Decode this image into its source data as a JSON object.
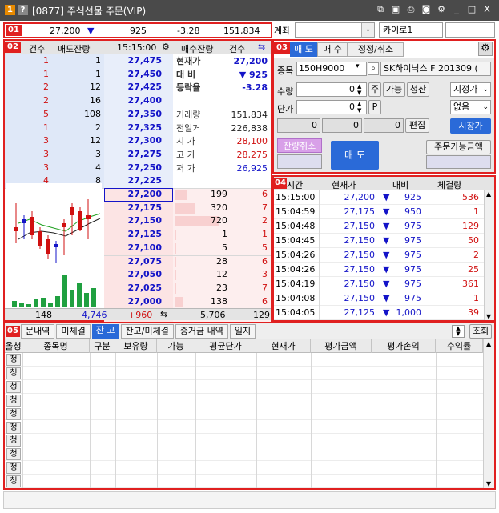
{
  "window": {
    "title": "[0877] 주식선물 주문(VIP)",
    "badge1": "1",
    "badge2": "?",
    "minimize": "_",
    "maximize": "□",
    "close": "X"
  },
  "sections": [
    "01",
    "02",
    "03",
    "04",
    "05"
  ],
  "quote_bar": {
    "price": "27,200",
    "arrow": "▼",
    "change": "925",
    "rate": "-3.28",
    "volume": "151,834"
  },
  "account": {
    "label": "계좌",
    "value": "",
    "name": "카이로1"
  },
  "orderbook": {
    "headers": {
      "count_l": "건수",
      "sell_qty": "매도잔량",
      "time": "15:15:00",
      "buy_qty": "매수잔량",
      "count_r": "건수"
    },
    "asks": [
      {
        "count": "1",
        "qty": "1",
        "price": "27,475"
      },
      {
        "count": "1",
        "qty": "1",
        "price": "27,450"
      },
      {
        "count": "2",
        "qty": "12",
        "price": "27,425"
      },
      {
        "count": "2",
        "qty": "16",
        "price": "27,400"
      },
      {
        "count": "5",
        "qty": "108",
        "price": "27,350"
      },
      {
        "count": "1",
        "qty": "2",
        "price": "27,325"
      },
      {
        "count": "3",
        "qty": "12",
        "price": "27,300"
      },
      {
        "count": "3",
        "qty": "3",
        "price": "27,275"
      },
      {
        "count": "3",
        "qty": "4",
        "price": "27,250"
      },
      {
        "count": "4",
        "qty": "8",
        "price": "27,225"
      }
    ],
    "bids": [
      {
        "price": "27,200",
        "qty": "199",
        "count": "6"
      },
      {
        "price": "27,175",
        "qty": "320",
        "count": "7"
      },
      {
        "price": "27,150",
        "qty": "720",
        "count": "2"
      },
      {
        "price": "27,125",
        "qty": "1",
        "count": "1"
      },
      {
        "price": "27,100",
        "qty": "5",
        "count": "5"
      },
      {
        "price": "27,075",
        "qty": "28",
        "count": "6"
      },
      {
        "price": "27,050",
        "qty": "12",
        "count": "3"
      },
      {
        "price": "27,025",
        "qty": "23",
        "count": "7"
      },
      {
        "price": "27,000",
        "qty": "138",
        "count": "6"
      },
      {
        "price": "26,975",
        "qty": "104",
        "count": "3"
      }
    ],
    "info": [
      {
        "label": "현재가",
        "value": "27,200",
        "cls": "blue"
      },
      {
        "label": "대 비",
        "value": "▼ 925",
        "cls": "blue"
      },
      {
        "label": "등락율",
        "value": "-3.28",
        "cls": "blue"
      },
      {
        "label": "",
        "value": "",
        "cls": ""
      },
      {
        "label": "거래량",
        "value": "151,834",
        "cls": "dark"
      },
      {
        "label": "전일거",
        "value": "226,838",
        "cls": "dark"
      },
      {
        "label": "시 가",
        "value": "28,100",
        "cls": "red"
      },
      {
        "label": "고 가",
        "value": "28,275",
        "cls": "red"
      },
      {
        "label": "저 가",
        "value": "26,925",
        "cls": "blue"
      }
    ],
    "footer": {
      "count_l": "148",
      "sell_total": "4,746",
      "diff": "+960",
      "buy_total": "5,706",
      "count_r": "129"
    }
  },
  "order": {
    "tabs": [
      "매 도",
      "매 수",
      "정정/취소"
    ],
    "code_label": "종목",
    "code": "150H9000",
    "name": "SK하이닉스 F 201309 (",
    "qty_label": "수량",
    "qty": "0",
    "qty_btn": "주",
    "avail_btn": "가능",
    "clear_btn": "청산",
    "price_type": "지정가",
    "price_label": "단가",
    "price": "0",
    "p_btn": "P",
    "cond": "없음",
    "v1": "0",
    "v2": "0",
    "v3": "0",
    "edit_btn": "편집",
    "market_btn": "시장가",
    "cancel_btn": "잔량취소",
    "sell_btn": "매 도",
    "avail_amt_btn": "주문가능금액"
  },
  "trades": {
    "headers": [
      "시간",
      "현재가",
      "대비",
      "체결량"
    ],
    "rows": [
      {
        "time": "15:15:00",
        "price": "27,200",
        "change": "925",
        "vol": "536"
      },
      {
        "time": "15:04:59",
        "price": "27,175",
        "change": "950",
        "vol": "1"
      },
      {
        "time": "15:04:48",
        "price": "27,150",
        "change": "975",
        "vol": "129"
      },
      {
        "time": "15:04:45",
        "price": "27,150",
        "change": "975",
        "vol": "50"
      },
      {
        "time": "15:04:26",
        "price": "27,150",
        "change": "975",
        "vol": "2"
      },
      {
        "time": "15:04:26",
        "price": "27,150",
        "change": "975",
        "vol": "25"
      },
      {
        "time": "15:04:19",
        "price": "27,150",
        "change": "975",
        "vol": "361"
      },
      {
        "time": "15:04:08",
        "price": "27,150",
        "change": "975",
        "vol": "1"
      },
      {
        "time": "15:04:05",
        "price": "27,125",
        "change": "1,000",
        "vol": "39"
      }
    ],
    "arrow": "▼"
  },
  "bottom": {
    "tabs": [
      "문내역",
      "미체결",
      "잔 고",
      "잔고/미체결",
      "증거금 내역",
      "일지"
    ],
    "lookup": "조회",
    "columns": [
      "올청",
      "종목명",
      "구분",
      "보유량",
      "가능",
      "평균단가",
      "현재가",
      "평가금액",
      "평가손익",
      "수익률"
    ],
    "row_label": "청",
    "row_count": 10
  },
  "colors": {
    "frame": "#e02020",
    "blue": "#1414c8",
    "red": "#d01010",
    "accent": "#2a6ad8"
  }
}
